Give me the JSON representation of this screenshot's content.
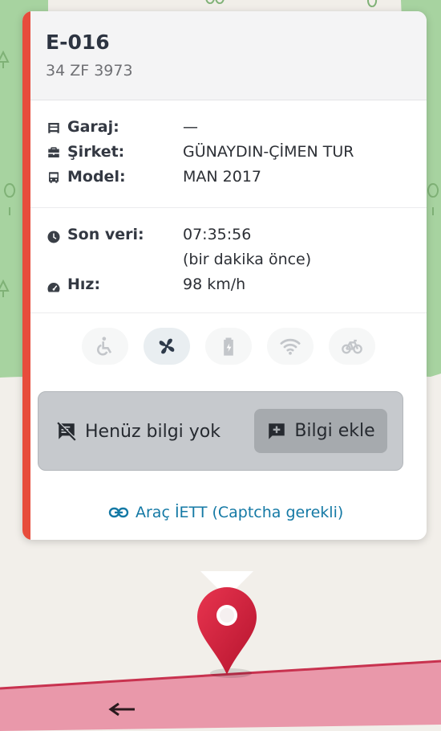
{
  "vehicle": {
    "code": "E-016",
    "plate": "34 ZF 3973"
  },
  "details": {
    "garage": {
      "icon": "garage-icon",
      "label": "Garaj:",
      "value": "—"
    },
    "company": {
      "icon": "briefcase-icon",
      "label": "Şirket:",
      "value": "GÜNAYDIN-ÇİMEN TUR"
    },
    "model": {
      "icon": "bus-icon",
      "label": "Model:",
      "value": "MAN 2017"
    }
  },
  "status": {
    "last_data": {
      "icon": "clock-icon",
      "label": "Son veri:",
      "value": "07:35:56",
      "relative": "(bir dakika önce)"
    },
    "speed": {
      "icon": "speedometer-icon",
      "label": "Hız:",
      "value": "98 km/h"
    }
  },
  "features": [
    {
      "name": "wheelchair-icon",
      "active": false
    },
    {
      "name": "fan-icon",
      "active": true
    },
    {
      "name": "battery-charging-icon",
      "active": false
    },
    {
      "name": "wifi-icon",
      "active": false
    },
    {
      "name": "bicycle-icon",
      "active": false
    }
  ],
  "info": {
    "empty_icon": "comment-off-icon",
    "empty_text": "Henüz bilgi yok",
    "add_icon": "comment-plus-icon",
    "add_label": "Bilgi ekle"
  },
  "link": {
    "icon": "link-icon",
    "label": "Araç İETT (Captcha gerekli)"
  },
  "colors": {
    "accent": "#e74c3c",
    "link": "#1479a5",
    "marker": "#d21f3c",
    "map_green": "#9ccb90",
    "route_pink": "#e27e93"
  }
}
